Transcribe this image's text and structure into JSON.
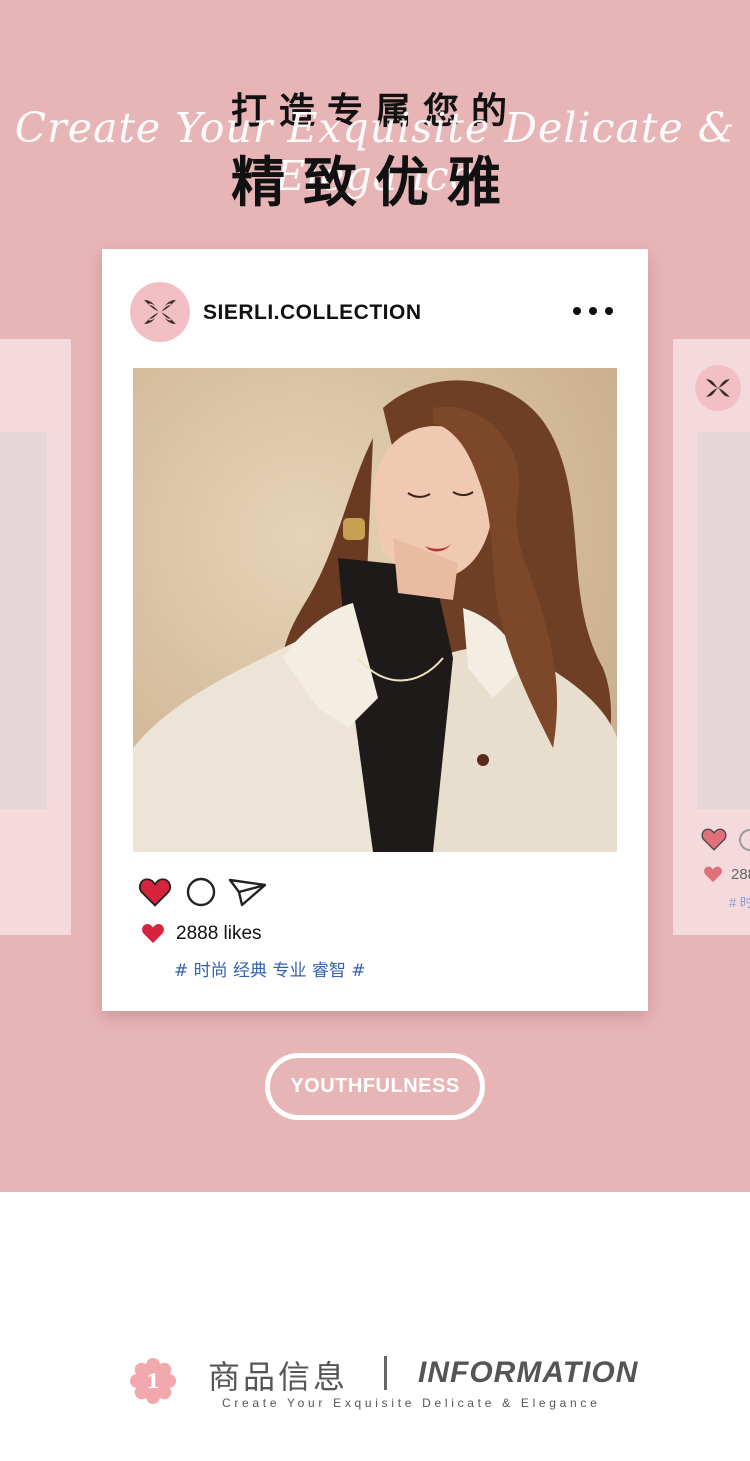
{
  "hero": {
    "title_line1": "打造专属您的",
    "script": "Create Your Exquisite Delicate & Elegance",
    "title_line2": "精致优雅",
    "background_color": "#e8b5b7"
  },
  "post": {
    "account": "SIERLI.COLLECTION",
    "more_icon": "more-dots-icon",
    "likes": "2888 likes",
    "tags": "# 时尚 经典 专业 睿智 #",
    "action_icons": [
      "heart-icon",
      "comment-icon",
      "share-icon"
    ],
    "accent_heart_color": "#d7233d",
    "tag_color": "#3461b1"
  },
  "side_cards": {
    "right_likes": "288",
    "right_tag": "# 时"
  },
  "button": {
    "label": "YOUTHFULNESS"
  },
  "section": {
    "number": "1",
    "title_cn": "商品信息",
    "title_en": "INFORMATION",
    "subtitle": "Create Your Exquisite Delicate & Elegance",
    "badge_color": "#f2a9ae"
  }
}
